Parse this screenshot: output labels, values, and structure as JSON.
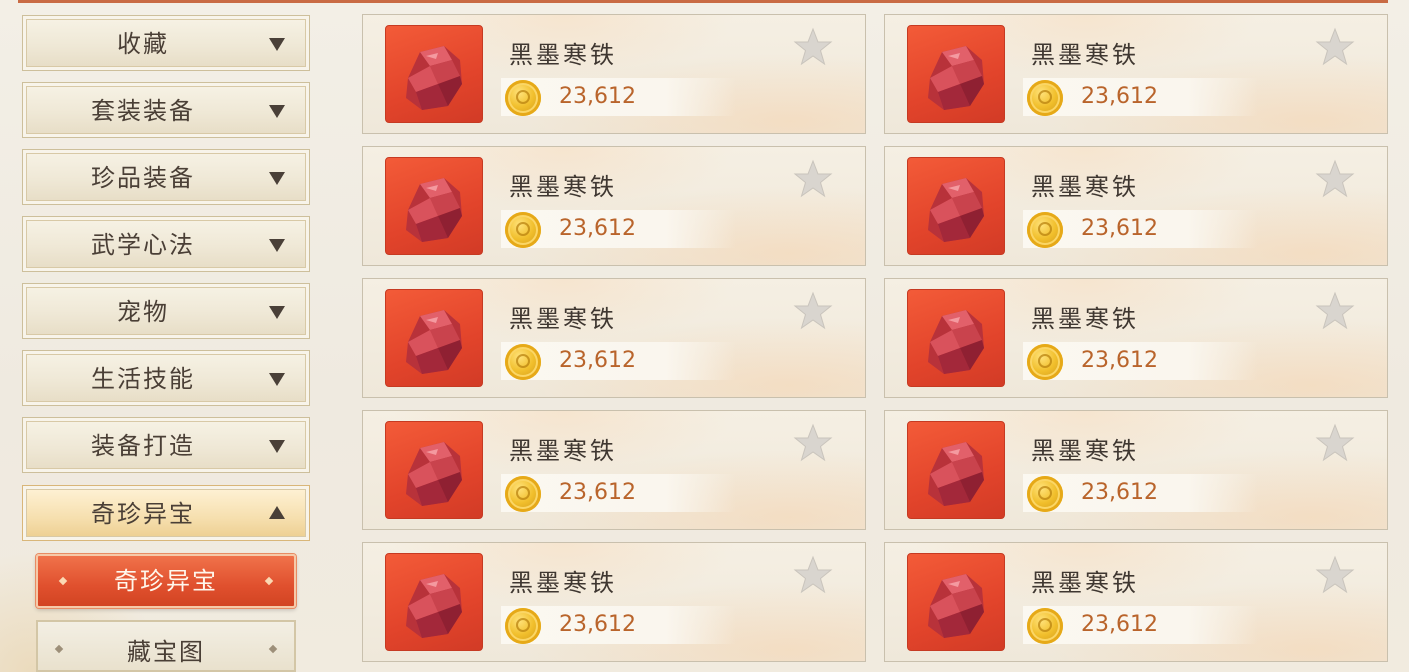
{
  "categories": [
    {
      "label": "收藏",
      "expanded": false
    },
    {
      "label": "套装装备",
      "expanded": false
    },
    {
      "label": "珍品装备",
      "expanded": false
    },
    {
      "label": "武学心法",
      "expanded": false
    },
    {
      "label": "宠物",
      "expanded": false
    },
    {
      "label": "生活技能",
      "expanded": false
    },
    {
      "label": "装备打造",
      "expanded": false
    },
    {
      "label": "奇珍异宝",
      "expanded": true
    }
  ],
  "subcategories": [
    {
      "label": "奇珍异宝",
      "selected": true
    },
    {
      "label": "藏宝图",
      "selected": false
    }
  ],
  "items": [
    {
      "name": "黑墨寒铁",
      "price": "23,612",
      "favorited": false
    },
    {
      "name": "黑墨寒铁",
      "price": "23,612",
      "favorited": false
    },
    {
      "name": "黑墨寒铁",
      "price": "23,612",
      "favorited": false
    },
    {
      "name": "黑墨寒铁",
      "price": "23,612",
      "favorited": false
    },
    {
      "name": "黑墨寒铁",
      "price": "23,612",
      "favorited": false
    },
    {
      "name": "黑墨寒铁",
      "price": "23,612",
      "favorited": false
    },
    {
      "name": "黑墨寒铁",
      "price": "23,612",
      "favorited": false
    },
    {
      "name": "黑墨寒铁",
      "price": "23,612",
      "favorited": false
    },
    {
      "name": "黑墨寒铁",
      "price": "23,612",
      "favorited": false
    },
    {
      "name": "黑墨寒铁",
      "price": "23,612",
      "favorited": false
    }
  ],
  "colors": {
    "accent": "#e0502e",
    "price_text": "#b9642b",
    "panel_bg": "#f3efe6"
  },
  "icons": {
    "item": "red-ore-icon",
    "currency": "gold-coin-icon",
    "favorite": "star-icon",
    "collapsed": "triangle-down-icon",
    "expanded": "triangle-up-icon"
  }
}
